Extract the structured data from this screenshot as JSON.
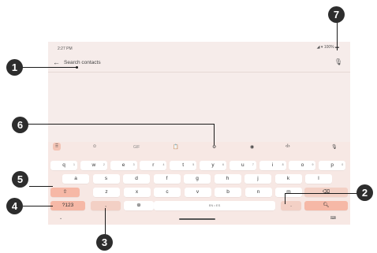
{
  "statusbar": {
    "time": "2:27 PM",
    "battery": "100%"
  },
  "search": {
    "placeholder": "Search contacts"
  },
  "toolbar": {
    "gif": "GIF"
  },
  "keyboard": {
    "row1": [
      {
        "k": "q",
        "n": "1"
      },
      {
        "k": "w",
        "n": "2"
      },
      {
        "k": "e",
        "n": "3"
      },
      {
        "k": "r",
        "n": "4"
      },
      {
        "k": "t",
        "n": "5"
      },
      {
        "k": "y",
        "n": "6"
      },
      {
        "k": "u",
        "n": "7"
      },
      {
        "k": "i",
        "n": "8"
      },
      {
        "k": "o",
        "n": "9"
      },
      {
        "k": "p",
        "n": "0"
      }
    ],
    "row2": [
      "a",
      "s",
      "d",
      "f",
      "g",
      "h",
      "j",
      "k",
      "l"
    ],
    "row3": [
      "z",
      "x",
      "c",
      "v",
      "b",
      "n",
      "m"
    ],
    "symbols_label": "?123",
    "comma": ",",
    "space_label": "EN • ES",
    "period": "."
  },
  "callouts": [
    "1",
    "2",
    "3",
    "4",
    "5",
    "6",
    "7"
  ],
  "colors": {
    "accent": "#f6b8a6",
    "keyboard_bg": "#f7e8e4",
    "callout": "#2d2d2d"
  }
}
